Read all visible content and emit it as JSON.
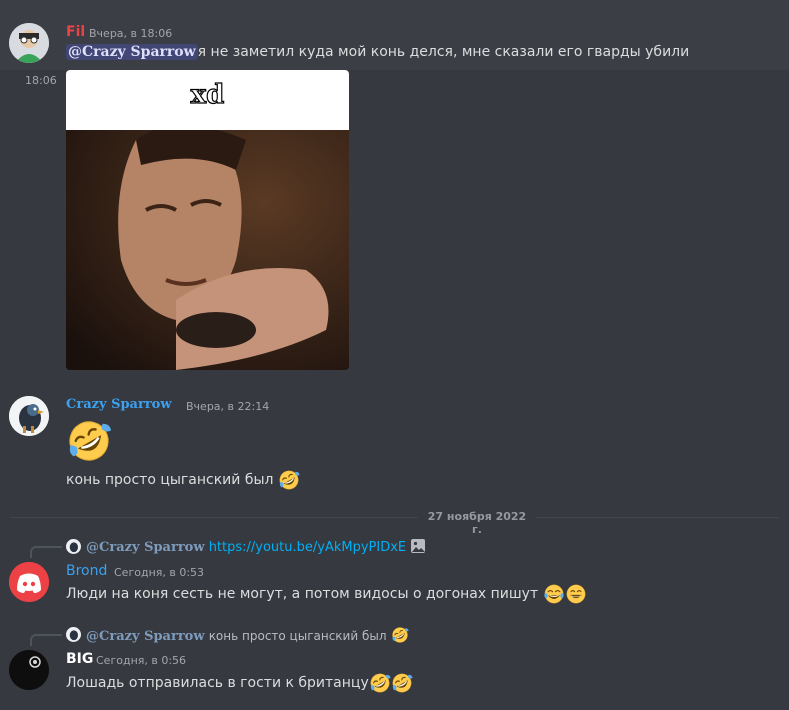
{
  "messages": [
    {
      "author": "Fil",
      "author_color": "#ed4245",
      "timestamp": "Вчера, в 18:06",
      "mention": "@Crazy Sparrow",
      "text": "я не заметил куда мой конь делся, мне сказали его гварды убили",
      "gif_time": "18:06",
      "gif_caption": "xd"
    },
    {
      "author": "Crazy Sparrow",
      "author_color": "#3ba1f0",
      "timestamp": "Вчера, в 22:14",
      "emoji_big": "rolling-on-floor-laughing",
      "text": "конь просто цыганский был"
    },
    {
      "reply_to": {
        "author": "@Crazy Sparrow",
        "text": "https://youtu.be/yAkMpyPIDxE"
      },
      "author": "Brond",
      "author_color": "#3ba1f0",
      "timestamp": "Сегодня, в 0:53",
      "text": "Люди на коня сесть не могут, а потом видосы о догонах пишут"
    },
    {
      "reply_to": {
        "author": "@Crazy Sparrow",
        "text": "конь просто цыганский был"
      },
      "author": "BIG",
      "author_color": "#ffffff",
      "timestamp": "Сегодня, в 0:56",
      "text": "Лошадь отправилась в гости к британцу"
    }
  ],
  "date_divider": "27 ноября 2022 г.",
  "colors": {
    "background": "#36393f",
    "highlight": "#3b3e45",
    "mention_bg": "#414675",
    "link": "#00aff4",
    "discord_red": "#ed4245"
  }
}
